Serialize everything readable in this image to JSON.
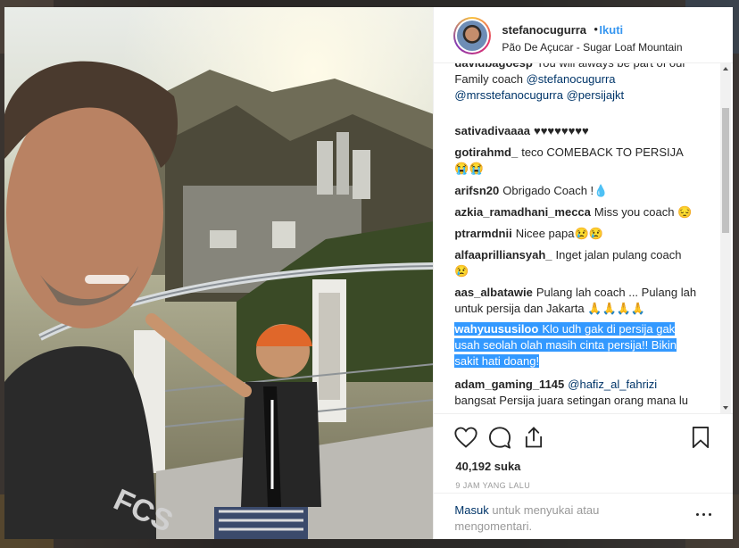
{
  "header": {
    "username": "stefanocugurra",
    "separator": "•",
    "follow_label": "Ikuti",
    "location": "Pão De Açucar - Sugar Loaf Mountain"
  },
  "comments": [
    {
      "user": "davidbagoesp",
      "text": "You will always be part of our Family coach",
      "mentions": "@stefanocugurra @mrsstefanocugurra @persijajkt"
    },
    {
      "user": "sativadivaaaa",
      "text": "♥♥♥♥♥♥♥♥"
    },
    {
      "user": "gotirahmd_",
      "text": "teco COMEBACK TO PERSIJA😭😭"
    },
    {
      "user": "arifsn20",
      "text": "Obrigado Coach !💧"
    },
    {
      "user": "azkia_ramadhani_mecca",
      "text": "Miss you coach 😔"
    },
    {
      "user": "ptrarmdnii",
      "text": "Nicee papa😢😢"
    },
    {
      "user": "alfaaprilliansyah_",
      "text": "Inget jalan pulang coach 😢"
    },
    {
      "user": "aas_albatawie",
      "text": "Pulang lah coach ... Pulang lah untuk persija dan Jakarta 🙏🙏🙏🙏"
    },
    {
      "user": "wahyuususiloo",
      "text": "Klo udh gak di persija gak usah seolah olah masih cinta persija!! Bikin sakit hati doang!"
    },
    {
      "user": "adam_gaming_1145",
      "mention": "@hafiz_al_fahrizi",
      "text": "bangsat Persija juara setingan orang mana lu"
    }
  ],
  "actions": {
    "like_icon": "heart-icon",
    "comment_icon": "comment-icon",
    "share_icon": "share-icon",
    "save_icon": "bookmark-icon",
    "likes": "40,192 suka",
    "time": "9 JAM YANG LALU"
  },
  "footer": {
    "login_link": "Masuk",
    "login_text": "untuk menyukai atau mengomentari."
  },
  "colors": {
    "link": "#3897f0",
    "mention": "#003569",
    "selection": "#3399ff"
  }
}
